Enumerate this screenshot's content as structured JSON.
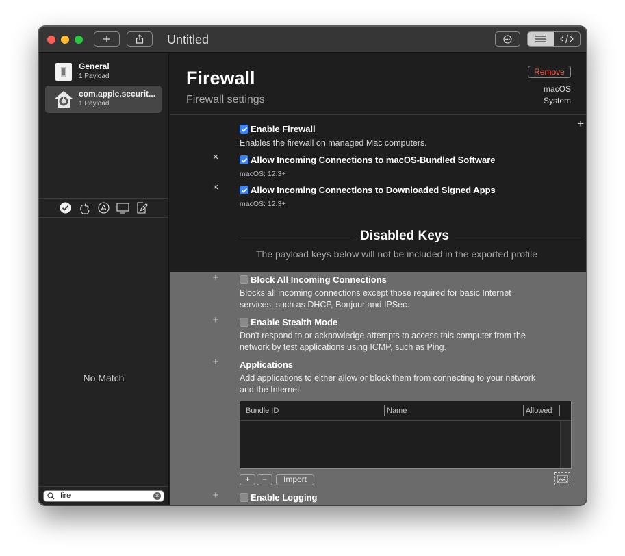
{
  "window": {
    "title": "Untitled",
    "toolbar": {
      "add_icon": "plus-icon",
      "share_icon": "share-icon",
      "more_icon": "ellipsis-circle-icon",
      "view_list_icon": "list-icon",
      "view_source_icon": "code-icon"
    }
  },
  "sidebar": {
    "payloads": [
      {
        "name": "General",
        "count": "1 Payload",
        "icon": "general-profile-icon"
      },
      {
        "name": "com.apple.securit...",
        "count": "1 Payload",
        "icon": "security-house-icon",
        "selected": true
      }
    ],
    "filters": [
      "checkmark-icon",
      "apple-icon",
      "app-store-icon",
      "display-icon",
      "document-edit-icon"
    ],
    "empty_text": "No Match",
    "search": {
      "value": "fire"
    }
  },
  "header": {
    "title": "Firewall",
    "subtitle": "Firewall settings",
    "remove_label": "Remove",
    "platform": "macOS",
    "scope": "System"
  },
  "enabled_keys": [
    {
      "label": "Enable Firewall",
      "description": "Enables the firewall on managed Mac computers.",
      "checked": true
    },
    {
      "label": "Allow Incoming Connections to macOS-Bundled Software",
      "version": "macOS: 12.3+",
      "checked": true
    },
    {
      "label": "Allow Incoming Connections to Downloaded Signed Apps",
      "version": "macOS: 12.3+",
      "checked": true
    }
  ],
  "disabled_section": {
    "title": "Disabled Keys",
    "subtitle": "The payload keys below will not be included in the exported profile"
  },
  "disabled_keys": {
    "block": {
      "label": "Block All Incoming Connections",
      "desc1": "Blocks all incoming connections except those required for basic Internet",
      "desc2": "services, such as DHCP, Bonjour and IPSec.",
      "checked": false
    },
    "stealth": {
      "label": "Enable Stealth Mode",
      "desc1": "Don't respond to or acknowledge attempts to access this computer from the",
      "desc2": "network by test applications using ICMP, such as Ping.",
      "checked": false
    },
    "apps": {
      "label": "Applications",
      "desc1": "Add applications to either allow or block them from connecting to your network",
      "desc2": "and the Internet.",
      "columns": [
        "Bundle ID",
        "Name",
        "Allowed"
      ],
      "import_label": "Import"
    },
    "logging": {
      "label": "Enable Logging",
      "checked": false
    }
  },
  "colors": {
    "window_bg": "#1e1e1e",
    "disabled_bg": "#6b6b6b",
    "accent": "#3b82f6",
    "remove": "#ff5b4f"
  }
}
